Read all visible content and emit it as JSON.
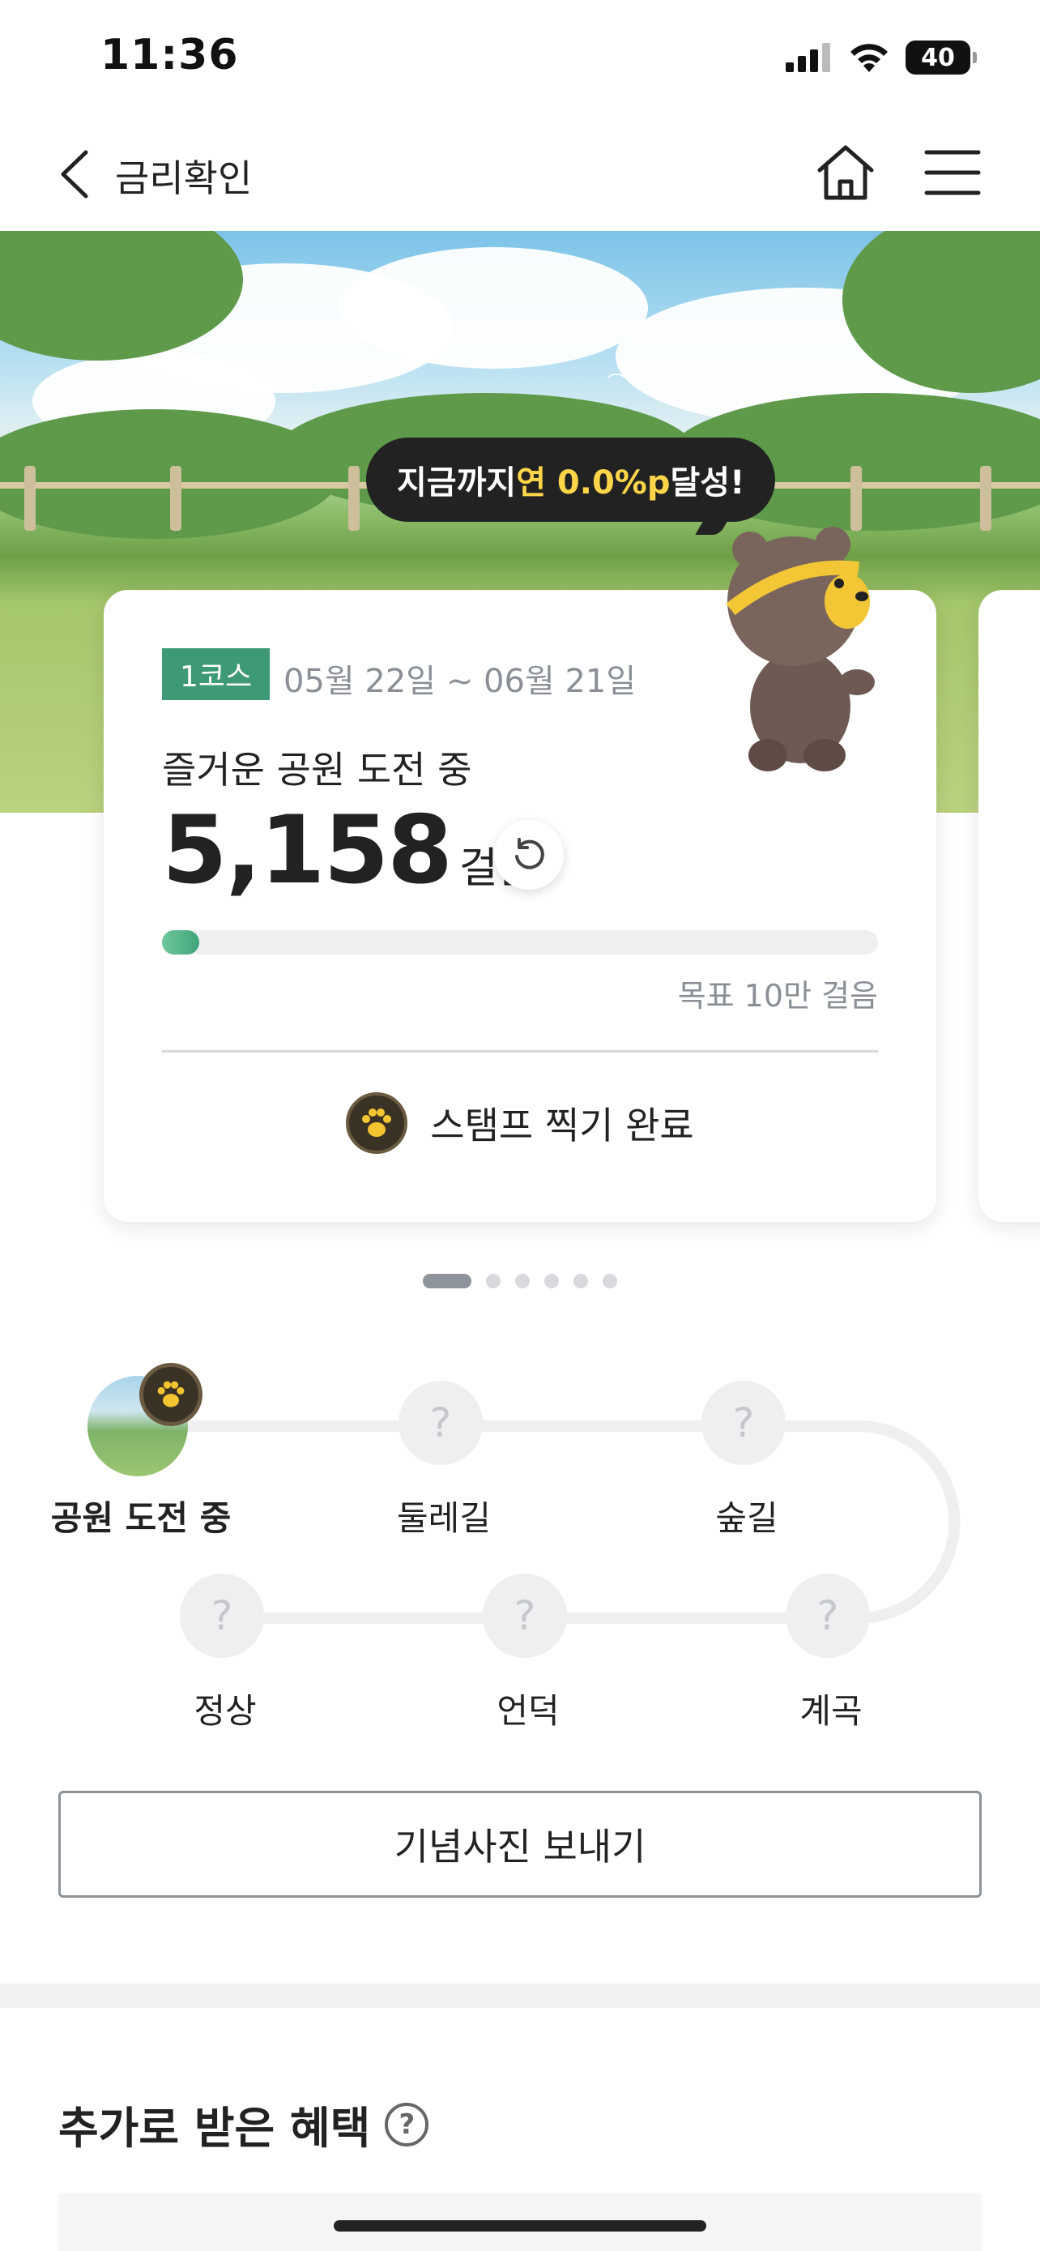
{
  "status_bar": {
    "time": "11:36",
    "battery": "40"
  },
  "nav": {
    "title": "금리확인"
  },
  "hero": {
    "bubble_prefix": "지금까지 ",
    "bubble_highlight": "연 0.0%p",
    "bubble_suffix": "달성!"
  },
  "card": {
    "course": "1코스",
    "period": "05월 22일 ~ 06월 21일",
    "status": "즐거운 공원 도전 중",
    "steps": "5,158",
    "steps_unit": "걸음",
    "progress_fraction": 0.05158,
    "goal": "목표 10만 걸음",
    "stamp_label": "스탬프 찍기 완료"
  },
  "pagination": {
    "count": 6,
    "active": 0
  },
  "course_map": {
    "nodes": [
      {
        "label": "공원 도전 중",
        "state": "current",
        "placeholder": ""
      },
      {
        "label": "둘레길",
        "state": "locked",
        "placeholder": "?"
      },
      {
        "label": "숲길",
        "state": "locked",
        "placeholder": "?"
      },
      {
        "label": "계곡",
        "state": "locked",
        "placeholder": "?"
      },
      {
        "label": "언덕",
        "state": "locked",
        "placeholder": "?"
      },
      {
        "label": "정상",
        "state": "locked",
        "placeholder": "?"
      }
    ]
  },
  "buttons": {
    "send_photo": "기념사진 보내기"
  },
  "benefits": {
    "title": "추가로 받은 혜택",
    "help": "?"
  },
  "colors": {
    "accent_green": "#3d9a74",
    "highlight_yellow": "#ffd54a"
  },
  "icons": [
    "back-icon",
    "home-icon",
    "menu-icon",
    "refresh-icon",
    "paw-icon",
    "help-icon"
  ]
}
